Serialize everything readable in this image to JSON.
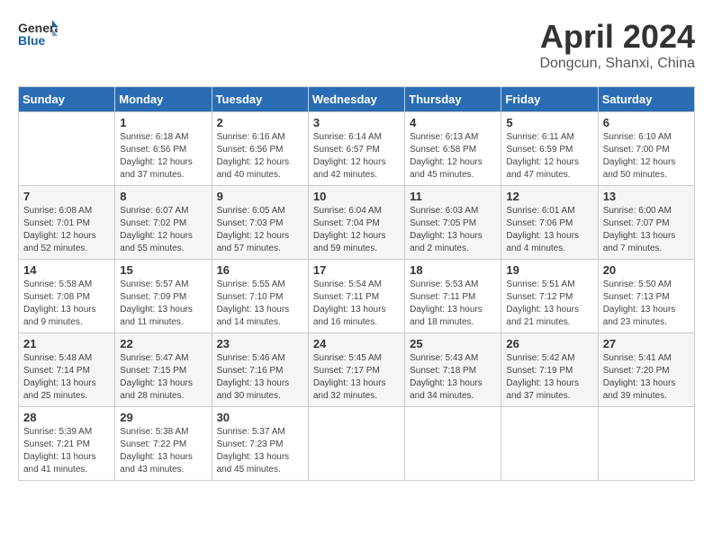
{
  "header": {
    "logo": {
      "general": "General",
      "blue": "Blue"
    },
    "title": "April 2024",
    "location": "Dongcun, Shanxi, China"
  },
  "calendar": {
    "weekdays": [
      "Sunday",
      "Monday",
      "Tuesday",
      "Wednesday",
      "Thursday",
      "Friday",
      "Saturday"
    ],
    "weeks": [
      [
        {
          "day": "",
          "info": ""
        },
        {
          "day": "1",
          "info": "Sunrise: 6:18 AM\nSunset: 6:56 PM\nDaylight: 12 hours\nand 37 minutes."
        },
        {
          "day": "2",
          "info": "Sunrise: 6:16 AM\nSunset: 6:56 PM\nDaylight: 12 hours\nand 40 minutes."
        },
        {
          "day": "3",
          "info": "Sunrise: 6:14 AM\nSunset: 6:57 PM\nDaylight: 12 hours\nand 42 minutes."
        },
        {
          "day": "4",
          "info": "Sunrise: 6:13 AM\nSunset: 6:58 PM\nDaylight: 12 hours\nand 45 minutes."
        },
        {
          "day": "5",
          "info": "Sunrise: 6:11 AM\nSunset: 6:59 PM\nDaylight: 12 hours\nand 47 minutes."
        },
        {
          "day": "6",
          "info": "Sunrise: 6:10 AM\nSunset: 7:00 PM\nDaylight: 12 hours\nand 50 minutes."
        }
      ],
      [
        {
          "day": "7",
          "info": "Sunrise: 6:08 AM\nSunset: 7:01 PM\nDaylight: 12 hours\nand 52 minutes."
        },
        {
          "day": "8",
          "info": "Sunrise: 6:07 AM\nSunset: 7:02 PM\nDaylight: 12 hours\nand 55 minutes."
        },
        {
          "day": "9",
          "info": "Sunrise: 6:05 AM\nSunset: 7:03 PM\nDaylight: 12 hours\nand 57 minutes."
        },
        {
          "day": "10",
          "info": "Sunrise: 6:04 AM\nSunset: 7:04 PM\nDaylight: 12 hours\nand 59 minutes."
        },
        {
          "day": "11",
          "info": "Sunrise: 6:03 AM\nSunset: 7:05 PM\nDaylight: 13 hours\nand 2 minutes."
        },
        {
          "day": "12",
          "info": "Sunrise: 6:01 AM\nSunset: 7:06 PM\nDaylight: 13 hours\nand 4 minutes."
        },
        {
          "day": "13",
          "info": "Sunrise: 6:00 AM\nSunset: 7:07 PM\nDaylight: 13 hours\nand 7 minutes."
        }
      ],
      [
        {
          "day": "14",
          "info": "Sunrise: 5:58 AM\nSunset: 7:08 PM\nDaylight: 13 hours\nand 9 minutes."
        },
        {
          "day": "15",
          "info": "Sunrise: 5:57 AM\nSunset: 7:09 PM\nDaylight: 13 hours\nand 11 minutes."
        },
        {
          "day": "16",
          "info": "Sunrise: 5:55 AM\nSunset: 7:10 PM\nDaylight: 13 hours\nand 14 minutes."
        },
        {
          "day": "17",
          "info": "Sunrise: 5:54 AM\nSunset: 7:11 PM\nDaylight: 13 hours\nand 16 minutes."
        },
        {
          "day": "18",
          "info": "Sunrise: 5:53 AM\nSunset: 7:11 PM\nDaylight: 13 hours\nand 18 minutes."
        },
        {
          "day": "19",
          "info": "Sunrise: 5:51 AM\nSunset: 7:12 PM\nDaylight: 13 hours\nand 21 minutes."
        },
        {
          "day": "20",
          "info": "Sunrise: 5:50 AM\nSunset: 7:13 PM\nDaylight: 13 hours\nand 23 minutes."
        }
      ],
      [
        {
          "day": "21",
          "info": "Sunrise: 5:48 AM\nSunset: 7:14 PM\nDaylight: 13 hours\nand 25 minutes."
        },
        {
          "day": "22",
          "info": "Sunrise: 5:47 AM\nSunset: 7:15 PM\nDaylight: 13 hours\nand 28 minutes."
        },
        {
          "day": "23",
          "info": "Sunrise: 5:46 AM\nSunset: 7:16 PM\nDaylight: 13 hours\nand 30 minutes."
        },
        {
          "day": "24",
          "info": "Sunrise: 5:45 AM\nSunset: 7:17 PM\nDaylight: 13 hours\nand 32 minutes."
        },
        {
          "day": "25",
          "info": "Sunrise: 5:43 AM\nSunset: 7:18 PM\nDaylight: 13 hours\nand 34 minutes."
        },
        {
          "day": "26",
          "info": "Sunrise: 5:42 AM\nSunset: 7:19 PM\nDaylight: 13 hours\nand 37 minutes."
        },
        {
          "day": "27",
          "info": "Sunrise: 5:41 AM\nSunset: 7:20 PM\nDaylight: 13 hours\nand 39 minutes."
        }
      ],
      [
        {
          "day": "28",
          "info": "Sunrise: 5:39 AM\nSunset: 7:21 PM\nDaylight: 13 hours\nand 41 minutes."
        },
        {
          "day": "29",
          "info": "Sunrise: 5:38 AM\nSunset: 7:22 PM\nDaylight: 13 hours\nand 43 minutes."
        },
        {
          "day": "30",
          "info": "Sunrise: 5:37 AM\nSunset: 7:23 PM\nDaylight: 13 hours\nand 45 minutes."
        },
        {
          "day": "",
          "info": ""
        },
        {
          "day": "",
          "info": ""
        },
        {
          "day": "",
          "info": ""
        },
        {
          "day": "",
          "info": ""
        }
      ]
    ]
  }
}
